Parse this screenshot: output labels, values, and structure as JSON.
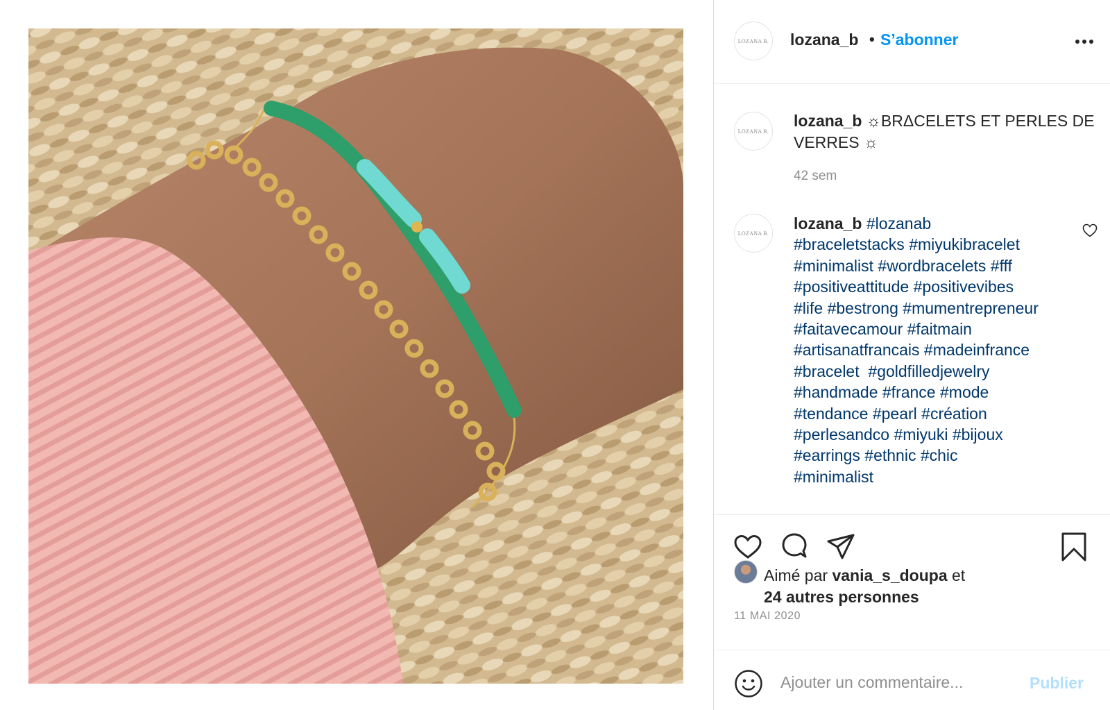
{
  "post": {
    "photo_description_icon": "bracelet-photo",
    "author": {
      "username": "lozana_b",
      "avatar_text": "LOZANA B.",
      "separator": "•",
      "follow_label": "S’abonner"
    },
    "caption": {
      "username": "lozana_b",
      "text_prefix": "☼BRΔCELETS ET PERLES DE VERRES ☼",
      "time": "42 sem"
    },
    "comment": {
      "username": "lozana_b",
      "lines": [
        "#lozanab",
        "#braceletstacks #miyukibracelet",
        "#minimalist #wordbracelets #fff",
        "#positiveattitude #positivevibes",
        "#life #bestrong #mumentrepreneur",
        "#faitavecamour #faitmain",
        "#artisanatfrancais #madeinfrance",
        "#bracelet  #goldfilledjewelry",
        "#handmade #france #mode",
        "#tendance #pearl #création",
        "#perlesandco #miyuki #bijoux",
        "#earrings #ethnic #chic",
        "#minimalist"
      ]
    },
    "likes": {
      "prefix": "Aimé par",
      "first_user": "vania_s_doupa",
      "conjunction": "et",
      "others": "24 autres personnes"
    },
    "date": "11 MAI 2020",
    "add_comment": {
      "placeholder": "Ajouter un commentaire...",
      "publish_label": "Publier"
    }
  },
  "colors": {
    "link_blue": "#0095f6",
    "hashtag": "#00376b",
    "muted": "#8e8e8e",
    "publish_disabled": "#b2dffc"
  }
}
